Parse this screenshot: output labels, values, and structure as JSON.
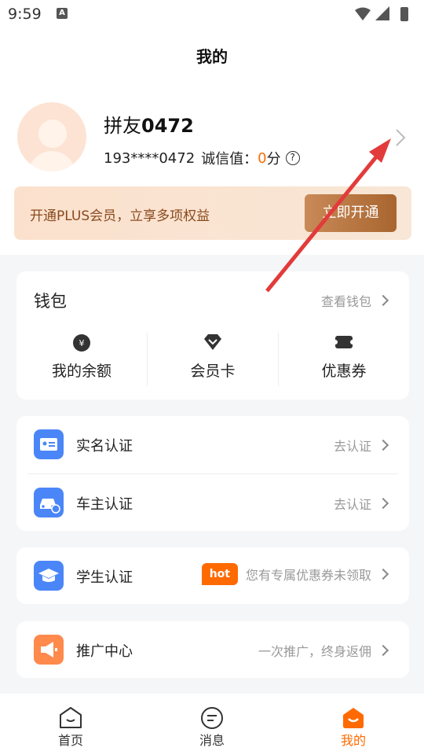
{
  "status": {
    "time": "9:59",
    "notification_letter": "A"
  },
  "header": {
    "title": "我的"
  },
  "profile": {
    "username_prefix": "拼友",
    "username_number": "0472",
    "phone": "193****0472",
    "credit_label": "诚信值：",
    "credit_value": "0",
    "credit_unit": "分",
    "help_symbol": "?"
  },
  "plus": {
    "text": "开通PLUS会员，立享多项权益",
    "button": "立即开通"
  },
  "wallet": {
    "title": "钱包",
    "link": "查看钱包",
    "items": [
      {
        "label": "我的余额",
        "icon": "money-bag-icon"
      },
      {
        "label": "会员卡",
        "icon": "diamond-icon"
      },
      {
        "label": "优惠券",
        "icon": "coupon-icon"
      }
    ]
  },
  "verify": {
    "rows": [
      {
        "label": "实名认证",
        "action": "去认证",
        "icon": "id-card-icon"
      },
      {
        "label": "车主认证",
        "action": "去认证",
        "icon": "car-icon"
      }
    ]
  },
  "student": {
    "label": "学生认证",
    "badge": "hot",
    "action": "您有专属优惠券未领取",
    "icon": "graduation-cap-icon"
  },
  "promo": {
    "label": "推广中心",
    "action": "一次推广，终身返佣",
    "icon": "megaphone-icon"
  },
  "tabs": [
    {
      "label": "首页",
      "icon": "home-smile-icon",
      "active": false
    },
    {
      "label": "消息",
      "icon": "message-icon",
      "active": false
    },
    {
      "label": "我的",
      "icon": "profile-smile-icon",
      "active": true
    }
  ],
  "colors": {
    "accent": "#ff6a00",
    "icon_blue": "#4a86f7",
    "icon_orange": "#ff8a4c",
    "gold": "#a8652f"
  }
}
